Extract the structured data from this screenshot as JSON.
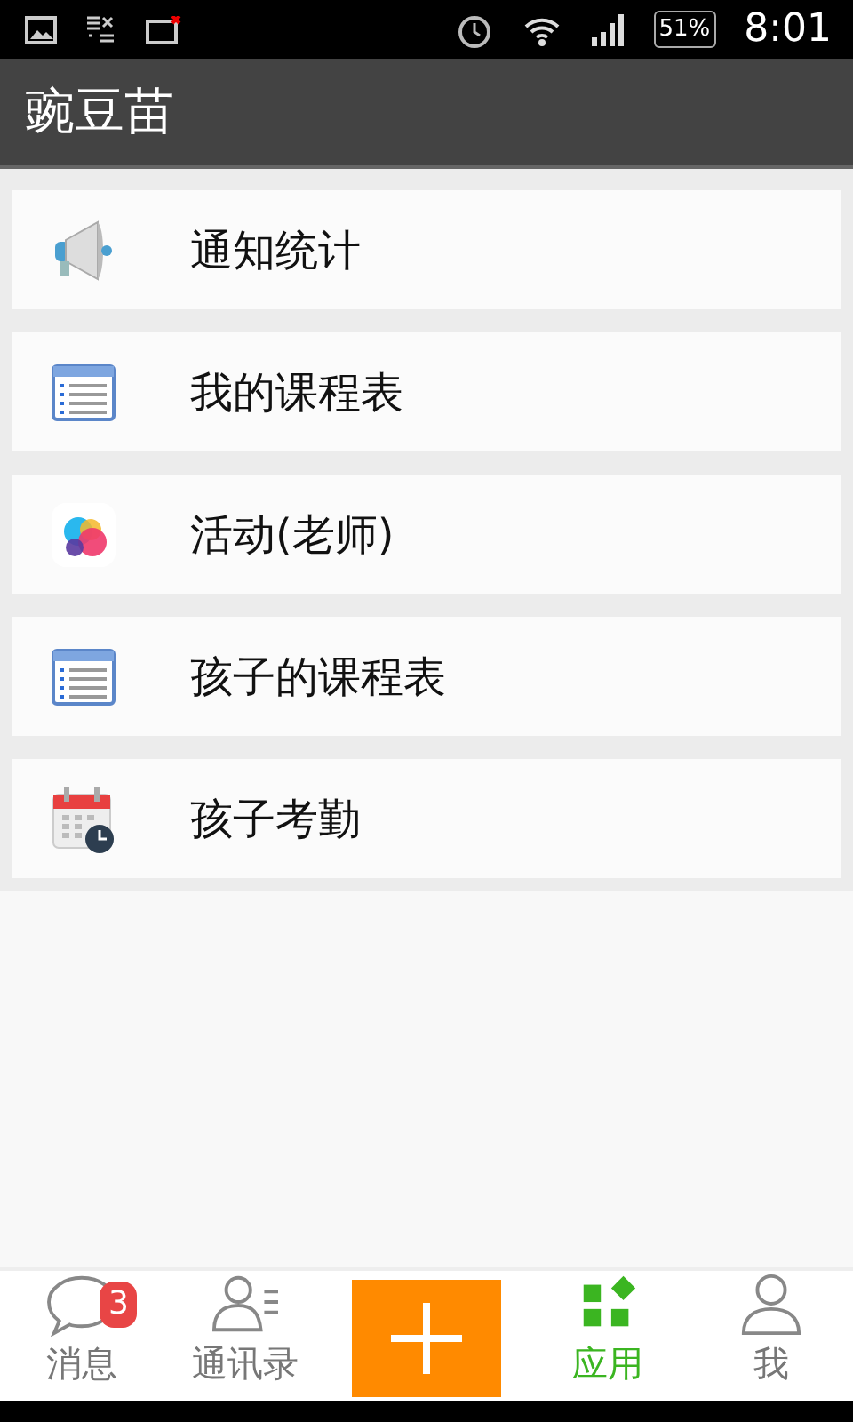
{
  "status_bar": {
    "battery": "51%",
    "time": "8:01"
  },
  "header": {
    "title": "豌豆苗"
  },
  "items": [
    {
      "label": "通知统计",
      "kind": "megaphone"
    },
    {
      "label": "我的课程表",
      "kind": "schedule"
    },
    {
      "label": "活动(老师)",
      "kind": "bubbles"
    },
    {
      "label": "孩子的课程表",
      "kind": "schedule"
    },
    {
      "label": "孩子考勤",
      "kind": "calendar"
    }
  ],
  "tabs": [
    {
      "label": "消息",
      "kind": "chat",
      "badge": "3",
      "selected": false
    },
    {
      "label": "通讯录",
      "kind": "contacts",
      "selected": false
    },
    {
      "kind": "add",
      "selected": false
    },
    {
      "label": "应用",
      "kind": "apps",
      "selected": true
    },
    {
      "label": "我",
      "kind": "me",
      "selected": false
    }
  ]
}
